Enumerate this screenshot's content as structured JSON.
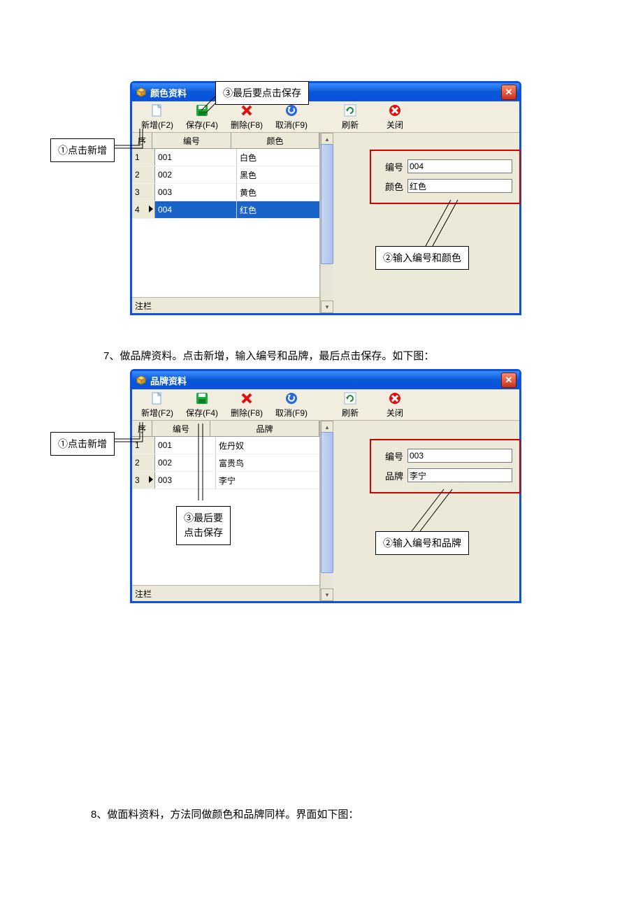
{
  "callouts": {
    "c1": "①点击新增",
    "c3": "③最后要点击保存",
    "c2a": "②输入编号和颜色",
    "c1b": "①点击新增",
    "c3b_line1": "③最后要",
    "c3b_line2": "点击保存",
    "c2b": "②输入编号和品牌"
  },
  "win1": {
    "title": "颜色资料",
    "toolbar": {
      "new": "新增(F2)",
      "save": "保存(F4)",
      "del": "删除(F8)",
      "cancel": "取消(F9)",
      "refresh": "刷新",
      "close": "关闭"
    },
    "headers": {
      "seq": "序",
      "code": "编号",
      "val": "颜色"
    },
    "rows": [
      {
        "seq": "1",
        "code": "001",
        "val": "白色",
        "sel": false,
        "cur": false
      },
      {
        "seq": "2",
        "code": "002",
        "val": "黑色",
        "sel": false,
        "cur": false
      },
      {
        "seq": "3",
        "code": "003",
        "val": "黄色",
        "sel": false,
        "cur": false
      },
      {
        "seq": "4",
        "code": "004",
        "val": "红色",
        "sel": true,
        "cur": true
      }
    ],
    "note": "注栏",
    "form": {
      "code_label": "编号",
      "code_value": "004",
      "val_label": "颜色",
      "val_value": "红色"
    }
  },
  "desc1": "7、做品牌资料。点击新增，输入编号和品牌，最后点击保存。如下图：",
  "win2": {
    "title": "品牌资料",
    "toolbar": {
      "new": "新增(F2)",
      "save": "保存(F4)",
      "del": "删除(F8)",
      "cancel": "取消(F9)",
      "refresh": "刷新",
      "close": "关闭"
    },
    "headers": {
      "seq": "序",
      "code": "编号",
      "val": "品牌"
    },
    "rows": [
      {
        "seq": "1",
        "code": "001",
        "val": "佐丹奴",
        "sel": false,
        "cur": false
      },
      {
        "seq": "2",
        "code": "002",
        "val": "富贵鸟",
        "sel": false,
        "cur": false
      },
      {
        "seq": "3",
        "code": "003",
        "val": "李宁",
        "sel": false,
        "cur": true
      }
    ],
    "note": "注栏",
    "form": {
      "code_label": "编号",
      "code_value": "003",
      "val_label": "品牌",
      "val_value": "李宁"
    }
  },
  "desc2": "8、做面料资料，方法同做颜色和品牌同样。界面如下图："
}
